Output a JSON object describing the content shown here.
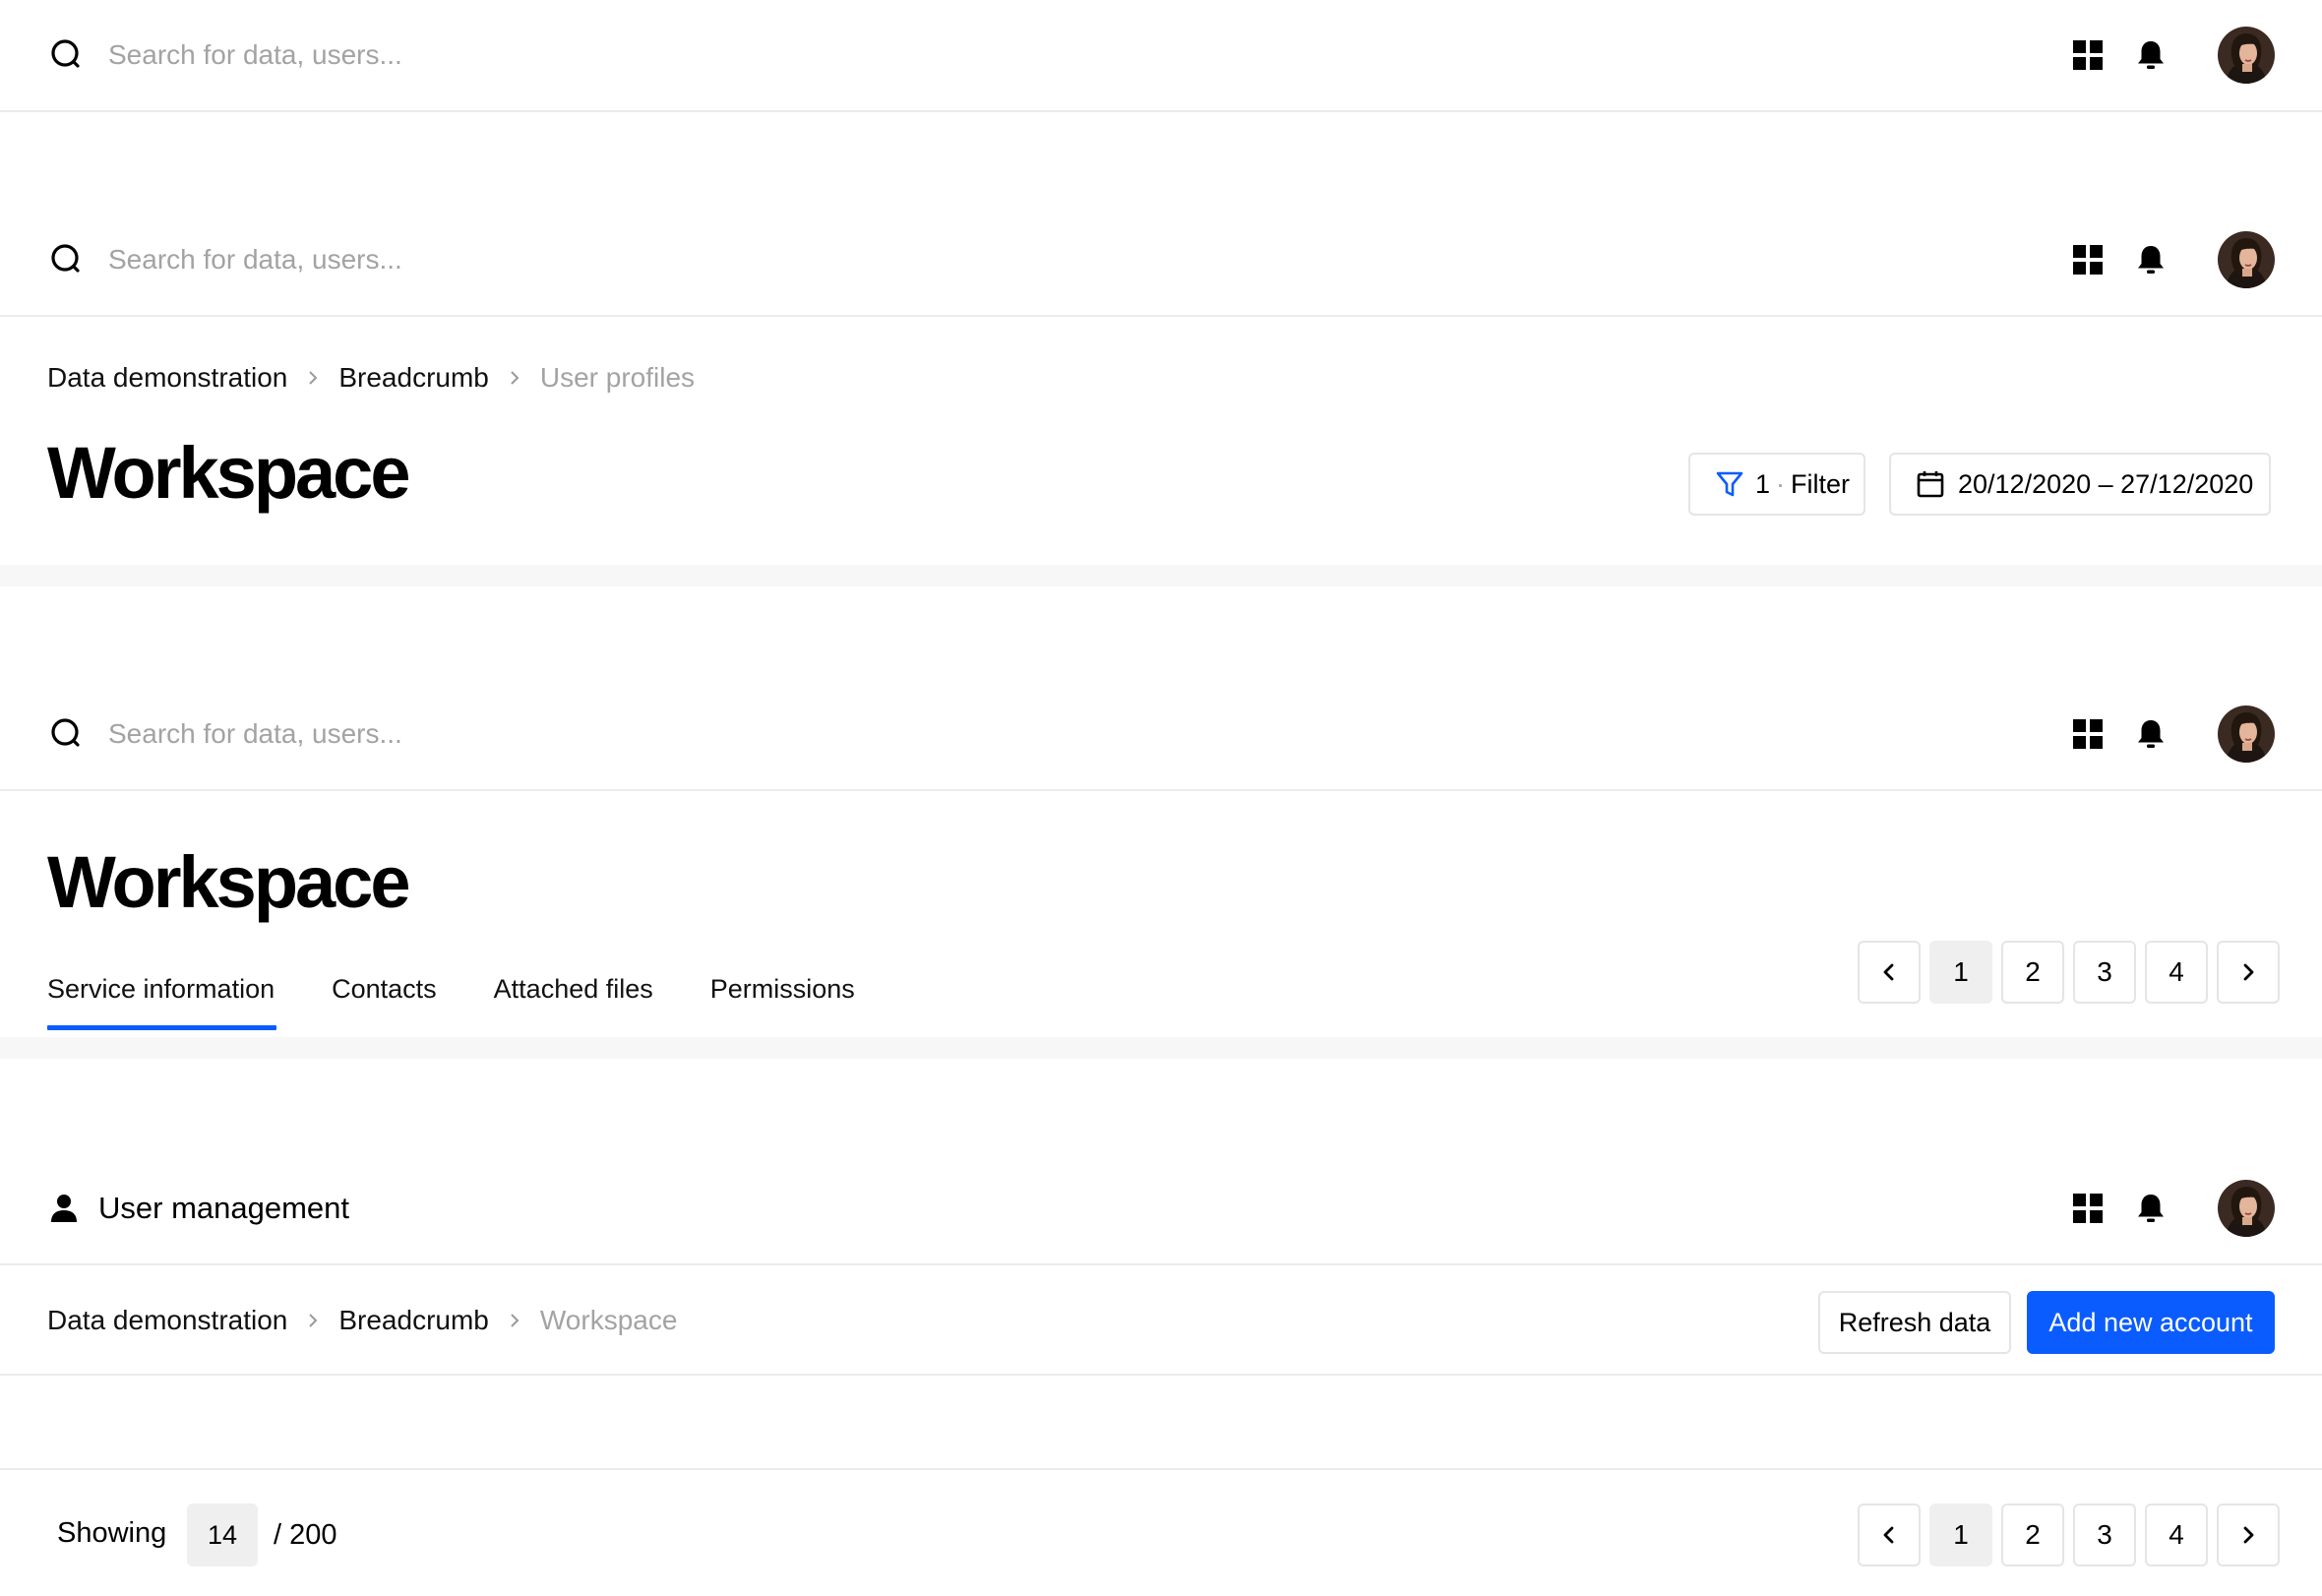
{
  "colors": {
    "accent": "#0a5cff",
    "muted_text": "#a3a3a3",
    "divider": "#ebebeb",
    "section_gap": "#f7f7f7"
  },
  "header": {
    "search_placeholder": "Search for data, users...",
    "icons": [
      "search-icon",
      "apps-grid-icon",
      "bell-icon",
      "user-avatar"
    ]
  },
  "section1": {},
  "section2": {
    "breadcrumb": [
      "Data demonstration",
      "Breadcrumb",
      "User profiles"
    ],
    "title": "Workspace",
    "filter": {
      "count": "1",
      "dot": "·",
      "label": "Filter"
    },
    "date_range": "20/12/2020 – 27/12/2020"
  },
  "section3": {
    "title": "Workspace",
    "tabs": [
      "Service information",
      "Contacts",
      "Attached files",
      "Permissions"
    ],
    "active_tab": "Service information",
    "pagination": {
      "pages": [
        "1",
        "2",
        "3",
        "4"
      ],
      "current": "1"
    }
  },
  "section4": {
    "header_title": "User management",
    "breadcrumb": [
      "Data demonstration",
      "Breadcrumb",
      "Workspace"
    ],
    "refresh_label": "Refresh data",
    "add_label": "Add new account",
    "showing_label": "Showing",
    "per_page": "14",
    "total": "/ 200",
    "pagination": {
      "pages": [
        "1",
        "2",
        "3",
        "4"
      ],
      "current": "1"
    }
  }
}
